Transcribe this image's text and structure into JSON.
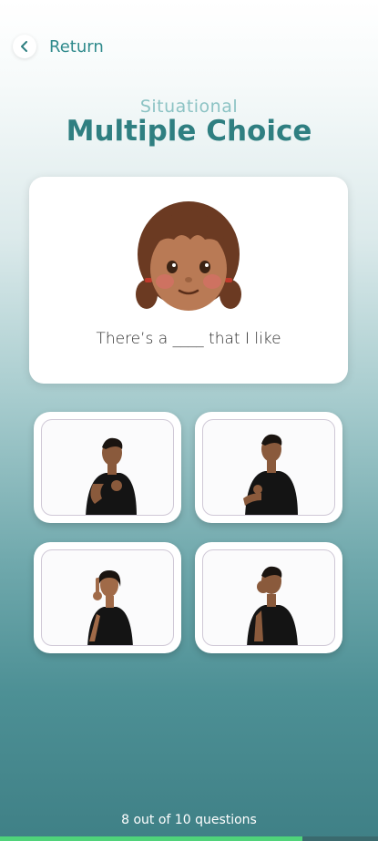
{
  "header": {
    "return_label": "Return",
    "subtitle": "Situational",
    "title": "Multiple Choice"
  },
  "question": {
    "image_icon": "girl-face-emoji",
    "sentence": "There’s a ____ that I like"
  },
  "options": [
    {
      "name": "sign-option-1",
      "icon": "person-signing-fist-chest"
    },
    {
      "name": "sign-option-2",
      "icon": "person-signing-open-hand"
    },
    {
      "name": "sign-option-3",
      "icon": "person-signing-finger-up"
    },
    {
      "name": "sign-option-4",
      "icon": "person-signing-hand-face"
    }
  ],
  "progress": {
    "text": "8 out of 10 questions",
    "fraction": 0.8,
    "fill_color": "#4fd37a"
  },
  "colors": {
    "accent": "#2f7f81",
    "subtitle": "#8cc3c4"
  }
}
